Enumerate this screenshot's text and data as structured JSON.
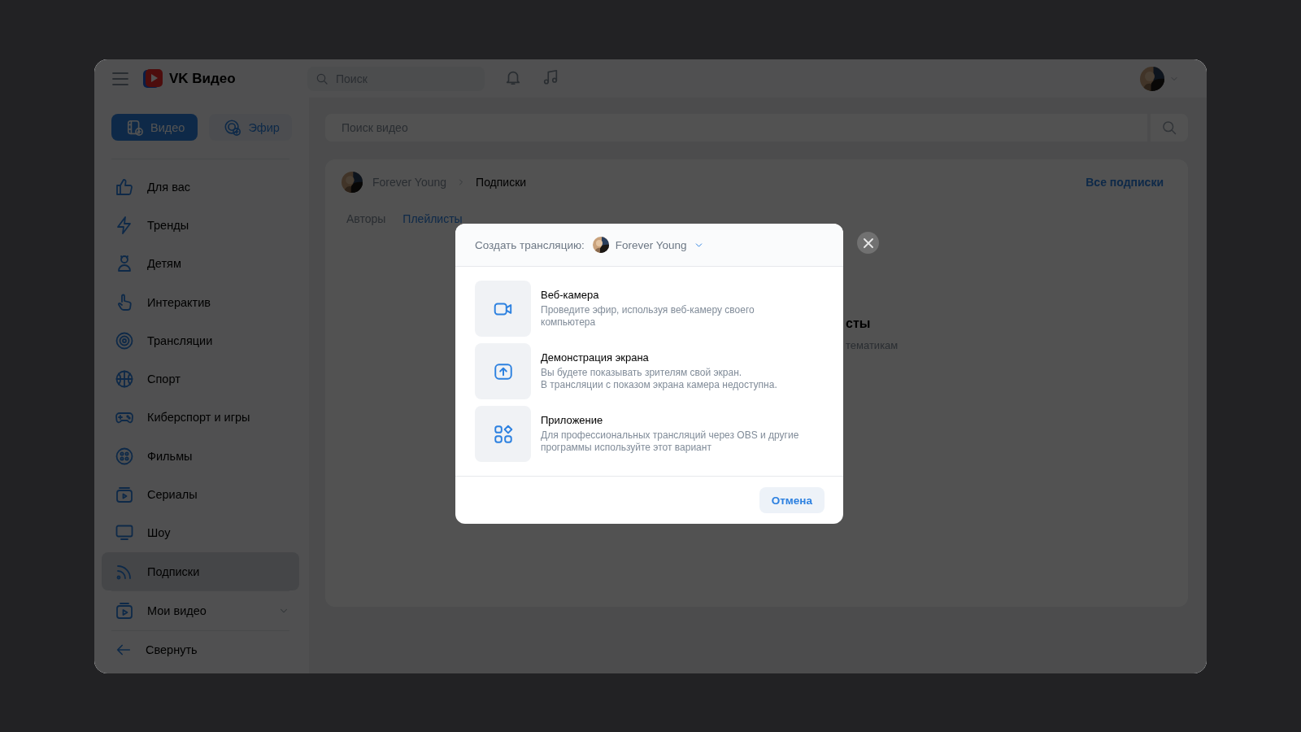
{
  "header": {
    "logo": "VK Видео",
    "search": {
      "placeholder": "Поиск"
    }
  },
  "sidebar": {
    "modes": [
      {
        "label": "Видео",
        "selected": true
      },
      {
        "label": "Эфир",
        "selected": false
      }
    ],
    "items": [
      {
        "label": "Для вас",
        "selected": false,
        "expandable": false
      },
      {
        "label": "Тренды",
        "selected": false,
        "expandable": false
      },
      {
        "label": "Детям",
        "selected": false,
        "expandable": false
      },
      {
        "label": "Интерактив",
        "selected": false,
        "expandable": false
      },
      {
        "label": "Трансляции",
        "selected": false,
        "expandable": false
      },
      {
        "label": "Спорт",
        "selected": false,
        "expandable": false
      },
      {
        "label": "Киберспорт и игры",
        "selected": false,
        "expandable": false
      },
      {
        "label": "Фильмы",
        "selected": false,
        "expandable": false
      },
      {
        "label": "Сериалы",
        "selected": false,
        "expandable": false
      },
      {
        "label": "Шоу",
        "selected": false,
        "expandable": false
      },
      {
        "label": "Подписки",
        "selected": true,
        "expandable": false
      },
      {
        "label": "Мои видео",
        "selected": false,
        "expandable": true
      }
    ],
    "collapse": "Свернуть"
  },
  "main": {
    "search": {
      "placeholder": "Поиск видео"
    },
    "breadcrumb": [
      "Forever Young",
      "Подписки"
    ],
    "all_link": "Все подписки",
    "tabs": [
      {
        "label": "Авторы",
        "selected": false
      },
      {
        "label": "Плейлисты",
        "selected": true
      }
    ],
    "empty_title": "сты",
    "empty_text": "тематикам"
  },
  "modal": {
    "title": "Создать трансляцию:",
    "account": "Forever Young",
    "options": [
      {
        "title": "Веб-камера",
        "description": "Проведите эфир, используя веб-камеру своего\nкомпьютера"
      },
      {
        "title": "Демонстрация экрана",
        "description": "Вы будете показывать зрителям свой экран.\nВ трансляции с показом экрана камера недоступна."
      },
      {
        "title": "Приложение",
        "description": "Для профессиональных трансляций через OBS и другие\nпрограммы используйте этот вариант"
      }
    ],
    "cancel": "Отмена"
  }
}
